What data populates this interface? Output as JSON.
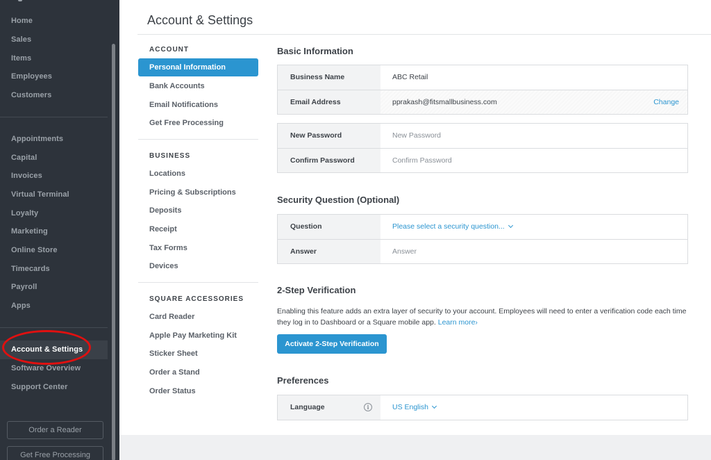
{
  "sidebar": {
    "primary_items": [
      {
        "label": "Home"
      },
      {
        "label": "Sales"
      },
      {
        "label": "Items"
      },
      {
        "label": "Employees"
      },
      {
        "label": "Customers"
      }
    ],
    "secondary_items": [
      {
        "label": "Appointments"
      },
      {
        "label": "Capital"
      },
      {
        "label": "Invoices"
      },
      {
        "label": "Virtual Terminal"
      },
      {
        "label": "Loyalty"
      },
      {
        "label": "Marketing"
      },
      {
        "label": "Online Store"
      },
      {
        "label": "Timecards"
      },
      {
        "label": "Payroll"
      },
      {
        "label": "Apps"
      }
    ],
    "tertiary_items": [
      {
        "label": "Account & Settings",
        "active": true
      },
      {
        "label": "Software Overview"
      },
      {
        "label": "Support Center"
      }
    ],
    "buttons": {
      "order_reader": "Order a Reader",
      "free_processing": "Get Free Processing"
    },
    "annotation": "red-circle-highlight"
  },
  "page": {
    "title": "Account & Settings"
  },
  "subnav": {
    "sections": [
      {
        "heading": "ACCOUNT",
        "items": [
          "Personal Information",
          "Bank Accounts",
          "Email Notifications",
          "Get Free Processing"
        ]
      },
      {
        "heading": "BUSINESS",
        "items": [
          "Locations",
          "Pricing & Subscriptions",
          "Deposits",
          "Receipt",
          "Tax Forms",
          "Devices"
        ]
      },
      {
        "heading": "SQUARE ACCESSORIES",
        "items": [
          "Card Reader",
          "Apple Pay Marketing Kit",
          "Sticker Sheet",
          "Order a Stand",
          "Order Status"
        ]
      }
    ],
    "active_item": "Personal Information"
  },
  "basic_info": {
    "title": "Basic Information",
    "business_name_label": "Business Name",
    "business_name_value": "ABC Retail",
    "email_label": "Email Address",
    "email_value": "pprakash@fitsmallbusiness.com",
    "change_link": "Change",
    "new_password_label": "New Password",
    "new_password_placeholder": "New Password",
    "confirm_password_label": "Confirm Password",
    "confirm_password_placeholder": "Confirm Password"
  },
  "security": {
    "title": "Security Question (Optional)",
    "question_label": "Question",
    "question_value": "Please select a security question...",
    "answer_label": "Answer",
    "answer_placeholder": "Answer"
  },
  "two_step": {
    "title": "2-Step Verification",
    "description": "Enabling this feature adds an extra layer of security to your account. Employees will need to enter a verification code each time they log in to Dashboard or a Square mobile app.",
    "learn_more": "Learn more›",
    "button_label": "Activate 2-Step Verification"
  },
  "preferences": {
    "title": "Preferences",
    "language_label": "Language",
    "language_value": "US English",
    "info_icon": "i"
  },
  "colors": {
    "accent": "#2b95d0",
    "sidebar_bg": "#2d333b",
    "annotation_red": "#e01010"
  }
}
